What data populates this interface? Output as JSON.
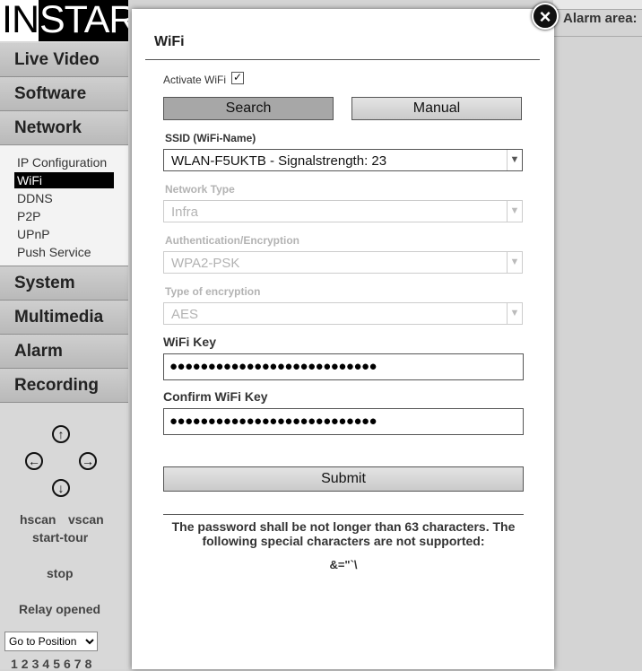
{
  "logo": {
    "part1": "IN",
    "part2": "STAR"
  },
  "menu": {
    "items": [
      "Live Video",
      "Software",
      "Network",
      "System",
      "Multimedia",
      "Alarm",
      "Recording"
    ],
    "network_sub": [
      "IP Configuration",
      "WiFi",
      "DDNS",
      "P2P",
      "UPnP",
      "Push Service"
    ],
    "active_sub": "WiFi"
  },
  "ptz": {
    "arrows": {
      "up": "↑",
      "left": "←",
      "right": "→",
      "down": "↓"
    },
    "hscan": "hscan",
    "vscan": "vscan",
    "start_tour": "start-tour",
    "stop": "stop",
    "relay": "Relay opened",
    "goto_select": "Go to Position",
    "positions": [
      "1",
      "2",
      "3",
      "4",
      "5",
      "6",
      "7",
      "8"
    ]
  },
  "background": {
    "alarm_area": "Alarm area:"
  },
  "modal": {
    "close": "×",
    "title": "WiFi",
    "activate_label": "Activate WiFi",
    "activate_checked": "✓",
    "search_button": "Search",
    "manual_button": "Manual",
    "ssid_label": "SSID (WiFi-Name)",
    "ssid_value": "WLAN-F5UKTB - Signalstrength: 23",
    "network_type_label": "Network Type",
    "network_type_value": "Infra",
    "auth_label": "Authentication/Encryption",
    "auth_value": "WPA2-PSK",
    "enc_type_label": "Type of encryption",
    "enc_type_value": "AES",
    "wifi_key_label": "WiFi Key",
    "wifi_key_value": "●●●●●●●●●●●●●●●●●●●●●●●●●●●",
    "confirm_key_label": "Confirm WiFi Key",
    "confirm_key_value": "●●●●●●●●●●●●●●●●●●●●●●●●●●●",
    "submit_button": "Submit",
    "note": "The password shall be not longer than 63 characters. The following special characters are not supported:",
    "unsupported_chars": "&=\"`\\"
  },
  "colors": {
    "menu_bg": "#c4c4c4",
    "active_sub_bg": "#000000",
    "pressed_button": "#a7a7a7",
    "disabled_text": "#b3b3b3"
  }
}
